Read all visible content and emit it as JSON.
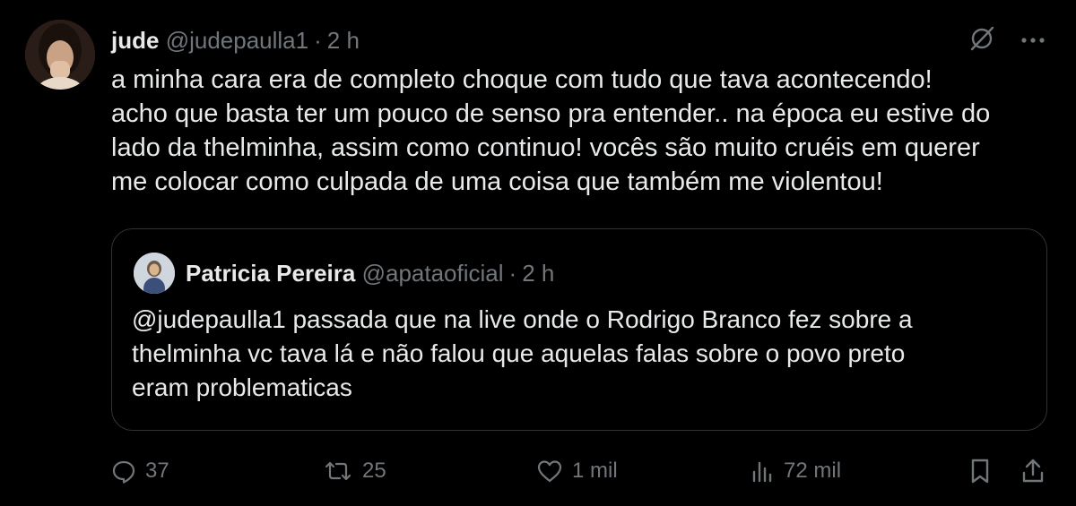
{
  "tweet": {
    "author_name": "jude",
    "author_handle": "@judepaulla1",
    "separator": "·",
    "time": "2 h",
    "text_lines": [
      "a minha cara era de completo choque com tudo que tava acontecendo!",
      "acho que basta ter um pouco de senso pra entender.. na época eu estive do",
      "lado da thelminha, assim como continuo! vocês são muito cruéis em querer",
      "me colocar como culpada de uma coisa que também me violentou!"
    ]
  },
  "quoted": {
    "author_name": "Patricia Pereira",
    "author_handle": "@apataoficial",
    "separator": "·",
    "time": "2 h",
    "text_lines": [
      "@judepaulla1 passada que na live onde o Rodrigo Branco fez sobre a",
      "thelminha vc tava lá e não falou que aquelas falas sobre o povo preto",
      "eram problematicas"
    ]
  },
  "actions": {
    "replies": "37",
    "reposts": "25",
    "likes": "1 mil",
    "views": "72 mil"
  },
  "icons": {
    "grok": "grok-icon",
    "more": "more-icon",
    "reply": "reply-icon",
    "repost": "repost-icon",
    "like": "heart-icon",
    "views": "views-icon",
    "bookmark": "bookmark-icon",
    "share": "share-icon"
  },
  "colors": {
    "background": "#000000",
    "text": "#e7e9ea",
    "muted": "#71767b",
    "border": "#2f3336"
  }
}
